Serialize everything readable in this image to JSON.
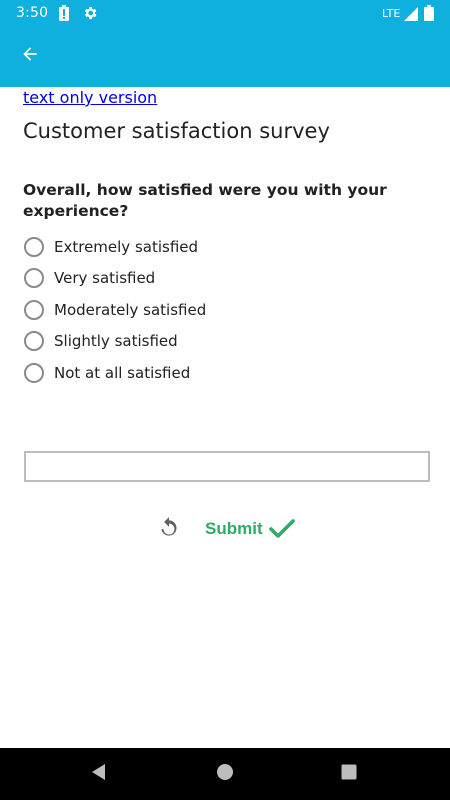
{
  "status_bar": {
    "time": "3:50",
    "network": "LTE",
    "icons": [
      "alert-icon",
      "gear-icon",
      "signal-icon",
      "battery-icon"
    ]
  },
  "app_bar": {
    "back_icon": "arrow-back-icon",
    "color": "#0fb0de"
  },
  "content": {
    "text_only_link": "text only version",
    "title": "Customer satisfaction survey",
    "question": "Overall, how satisfied were you with your experience?",
    "options": [
      "Extremely satisfied",
      "Very satisfied",
      "Moderately satisfied",
      "Slightly satisfied",
      "Not at all satisfied"
    ],
    "comment_value": "",
    "reset_icon": "reset-icon",
    "submit_label": "Submit",
    "submit_color": "#2eac68"
  },
  "nav_bar": {
    "buttons": [
      "back-triangle-icon",
      "home-circle-icon",
      "recents-square-icon"
    ]
  }
}
